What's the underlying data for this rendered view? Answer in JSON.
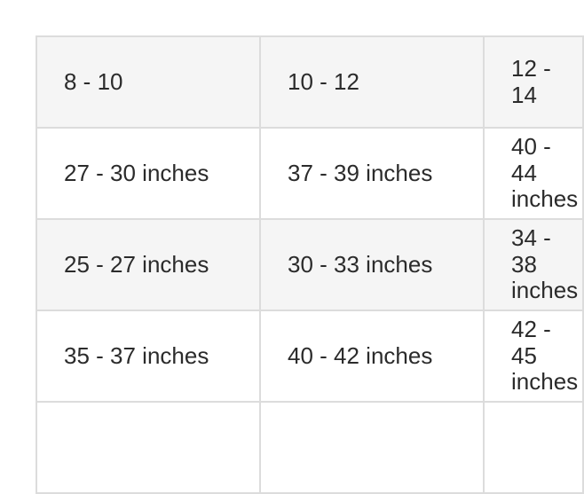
{
  "size_table": {
    "rows": [
      [
        "8 - 10",
        "10 - 12",
        "12 - 14"
      ],
      [
        "27 - 30 inches",
        "37 - 39 inches",
        "40 - 44 inches"
      ],
      [
        "25 - 27 inches",
        "30 - 33 inches",
        "34 - 38 inches"
      ],
      [
        "35 - 37 inches",
        "40 - 42 inches",
        "42 - 45 inches"
      ],
      [
        "",
        "",
        ""
      ]
    ]
  }
}
